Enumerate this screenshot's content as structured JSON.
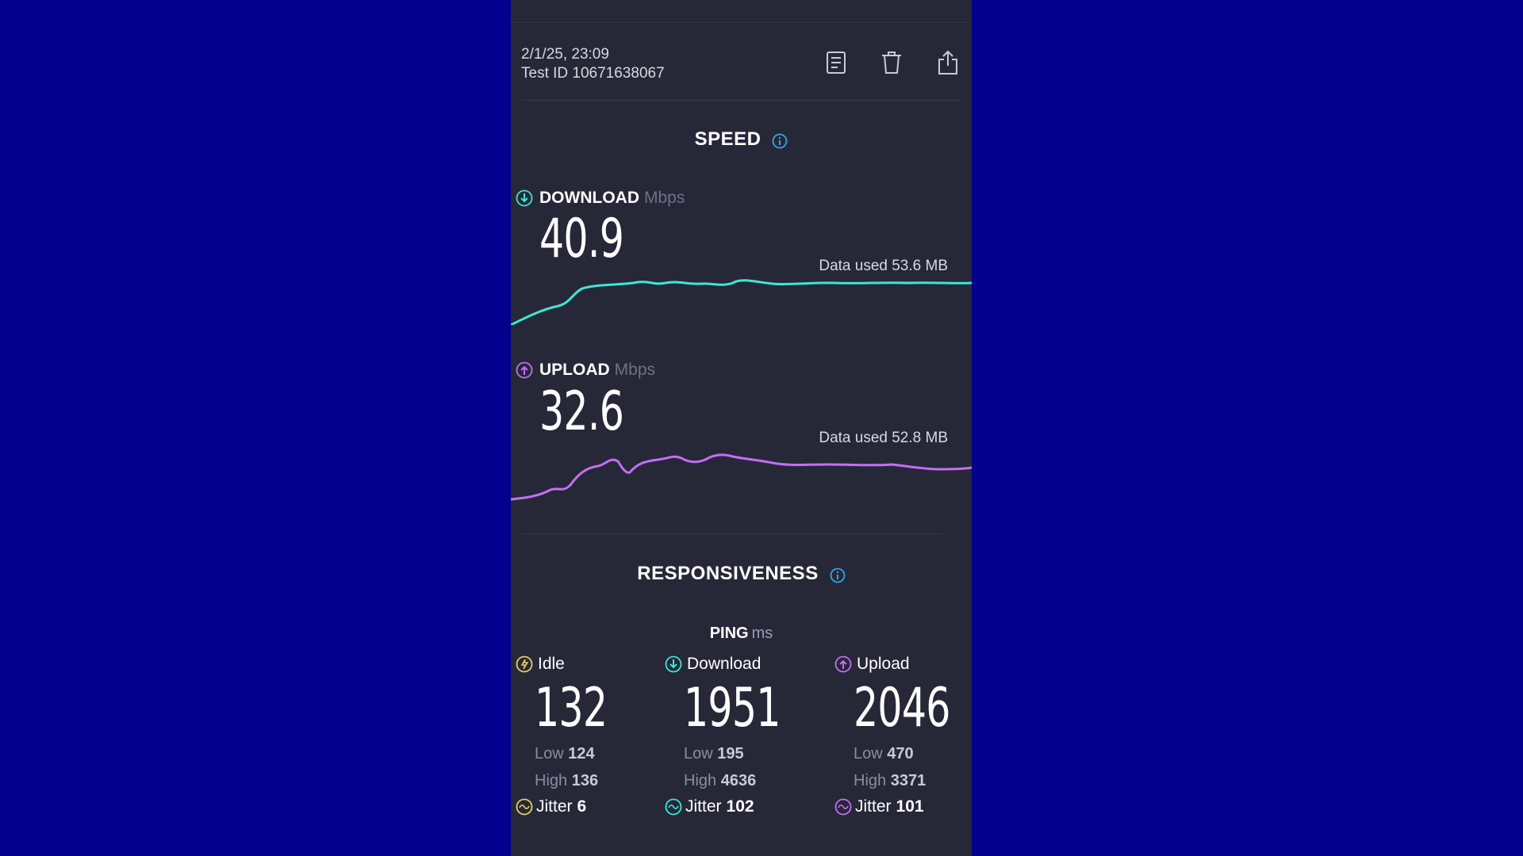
{
  "colors": {
    "background": "#02008c",
    "panel": "#262838",
    "download": "#3ee6d6",
    "upload": "#c46ef5",
    "idle": "#e8d060",
    "info": "#2fa8e8"
  },
  "header": {
    "date": "2/1/25, 23:09",
    "test_id": "Test ID 10671638067",
    "icons": [
      "results-list-icon",
      "trash-icon",
      "share-icon"
    ]
  },
  "speed": {
    "title": "SPEED",
    "download": {
      "label": "DOWNLOAD",
      "unit": "Mbps",
      "value": "40.9",
      "data_used": "Data used 53.6 MB"
    },
    "upload": {
      "label": "UPLOAD",
      "unit": "Mbps",
      "value": "32.6",
      "data_used": "Data used 52.8 MB"
    }
  },
  "responsiveness": {
    "title": "RESPONSIVENESS",
    "ping_label": "PING",
    "ping_unit": "ms",
    "columns": [
      {
        "label": "Idle",
        "value": "132",
        "low_label": "Low",
        "low": "124",
        "high_label": "High",
        "high": "136",
        "jitter_label": "Jitter",
        "jitter": "6"
      },
      {
        "label": "Download",
        "value": "1951",
        "low_label": "Low",
        "low": "195",
        "high_label": "High",
        "high": "4636",
        "jitter_label": "Jitter",
        "jitter": "102"
      },
      {
        "label": "Upload",
        "value": "2046",
        "low_label": "Low",
        "low": "470",
        "high_label": "High",
        "high": "3371",
        "jitter_label": "Jitter",
        "jitter": "101"
      }
    ]
  }
}
